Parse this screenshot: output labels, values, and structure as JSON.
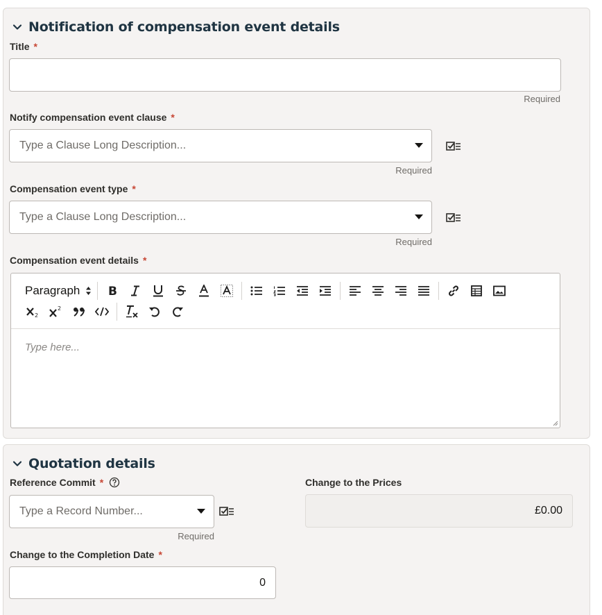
{
  "section1": {
    "title": "Notification of compensation event details",
    "fields": {
      "title": {
        "label": "Title",
        "value": "",
        "hint": "Required"
      },
      "clause": {
        "label": "Notify compensation event clause",
        "placeholder": "Type a Clause Long Description...",
        "hint": "Required"
      },
      "type": {
        "label": "Compensation event type",
        "placeholder": "Type a Clause Long Description...",
        "hint": "Required"
      },
      "details": {
        "label": "Compensation event details",
        "placeholder": "Type here..."
      }
    },
    "editor": {
      "format_select": "Paragraph"
    }
  },
  "section2": {
    "title": "Quotation details",
    "reference_commit": {
      "label": "Reference Commit",
      "placeholder": "Type a Record Number...",
      "hint": "Required"
    },
    "change_prices": {
      "label": "Change to the Prices",
      "value": "£0.00"
    },
    "change_completion": {
      "label": "Change to the Completion Date",
      "value": "0"
    }
  },
  "required_marker": "*",
  "colors": {
    "required": "#c74634",
    "section_title": "#1f3442",
    "section_bg": "#f5f3f2"
  }
}
